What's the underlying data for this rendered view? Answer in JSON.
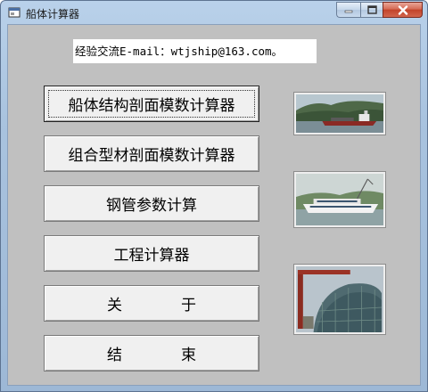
{
  "window": {
    "title": "船体计算器"
  },
  "email_label": "经验交流E-mail：wtjship@163.com。",
  "buttons": {
    "hull_section": "船体结构剖面模数计算器",
    "combined_section": "组合型材剖面模数计算器",
    "steel_pipe": "钢管参数计算",
    "engineering_calc": "工程计算器",
    "about_left": "关",
    "about_right": "于",
    "exit_left": "结",
    "exit_right": "束"
  },
  "photos": {
    "ship1": "cargo-ship-photo",
    "ship2": "passenger-ferry-photo",
    "ship3": "hull-under-construction-photo"
  }
}
